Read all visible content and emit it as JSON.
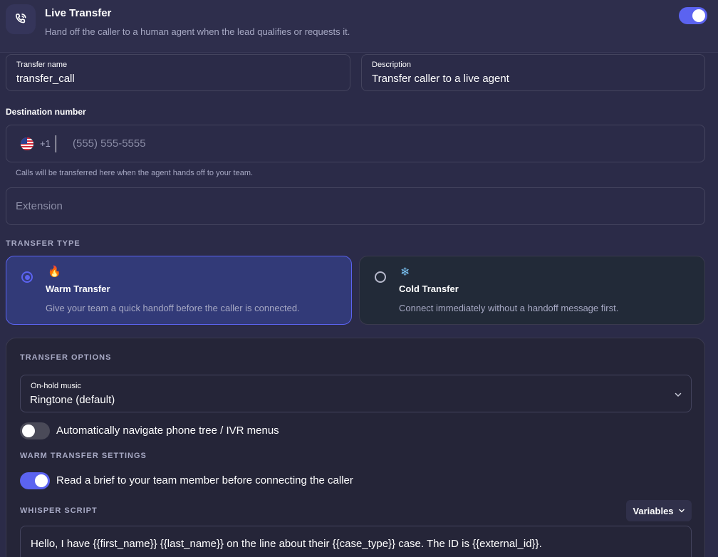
{
  "header": {
    "icon": "phone-transfer-icon",
    "title": "Live Transfer",
    "subtitle": "Hand off the caller to a human agent when the lead qualifies or requests it.",
    "enabled": true
  },
  "transfer_name": {
    "label": "Transfer name",
    "value": "transfer_call"
  },
  "description": {
    "label": "Description",
    "value": "Transfer caller to a live agent"
  },
  "destination": {
    "label": "Destination number",
    "flag": "us-flag-icon",
    "country_code": "+1",
    "placeholder": "(555) 555-5555",
    "help": "Calls will be transferred here when the agent hands off to your team."
  },
  "extension": {
    "placeholder": "Extension"
  },
  "transfer_type": {
    "label": "TRANSFER TYPE",
    "options": [
      {
        "emoji": "🔥",
        "title": "Warm Transfer",
        "description": "Give your team a quick handoff before the caller is connected.",
        "selected": true
      },
      {
        "emoji": "❄",
        "title": "Cold Transfer",
        "description": "Connect immediately without a handoff message first.",
        "selected": false
      }
    ]
  },
  "options_panel": {
    "label": "TRANSFER OPTIONS",
    "hold_music": {
      "label": "On-hold music",
      "value": "Ringtone (default)"
    },
    "ivr_toggle": {
      "label": "Automatically navigate phone tree / IVR menus",
      "enabled": false
    },
    "warm_settings_label": "WARM TRANSFER SETTINGS",
    "brief_toggle": {
      "label": "Read a brief to your team member before connecting the caller",
      "enabled": true
    },
    "whisper_label": "WHISPER SCRIPT",
    "variables_button": "Variables",
    "whisper_script": "Hello, I have {{first_name}} {{last_name}} on the line about their {{case_type}} case. The ID is {{external_id}}."
  },
  "colors": {
    "accent": "#5b63f0",
    "background": "#2b2b48",
    "panel": "#252538"
  }
}
